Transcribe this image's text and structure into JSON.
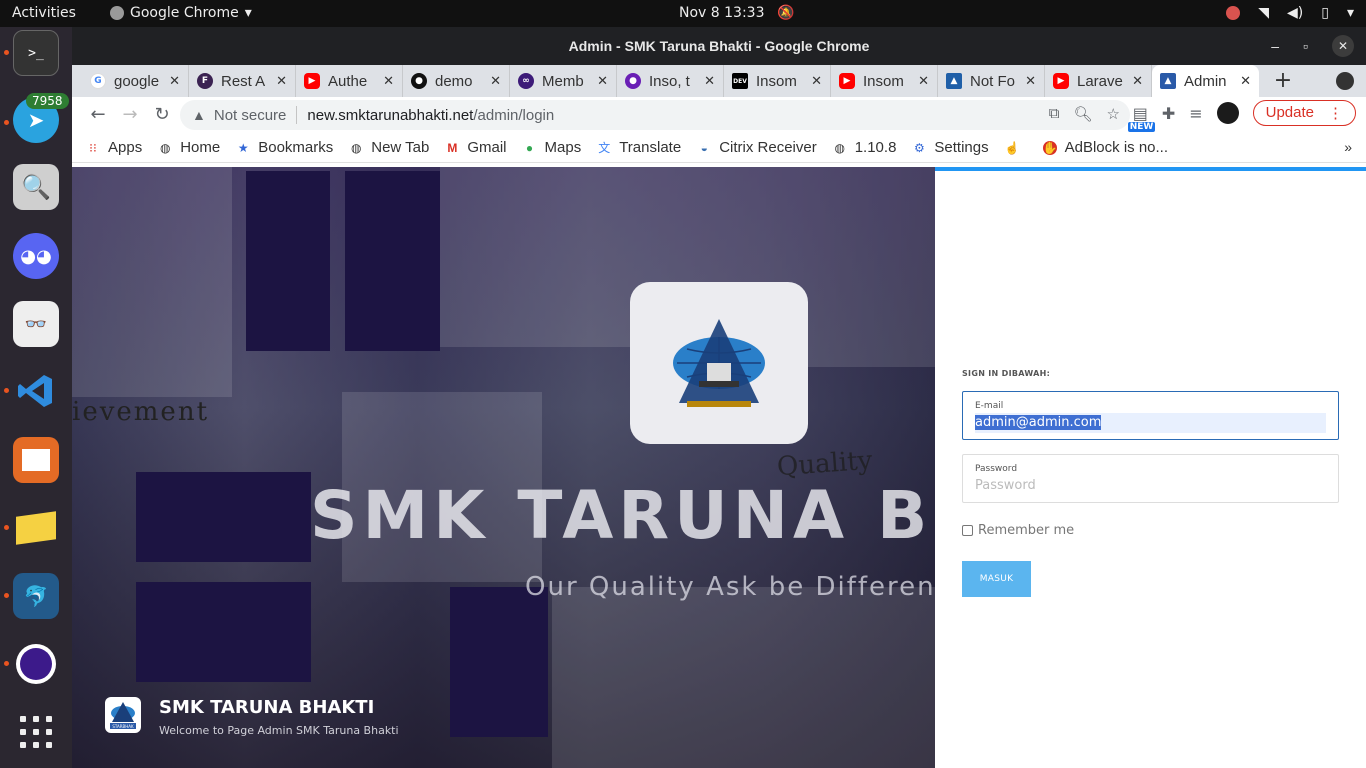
{
  "system": {
    "activities": "Activities",
    "app_name": "Google Chrome",
    "clock": "Nov 8  13:33"
  },
  "dock": {
    "telegram_badge": "7958",
    "items": [
      "terminal-icon",
      "telegram-icon",
      "magnifier-icon",
      "discord-icon",
      "document-viewer-icon",
      "vscode-icon",
      "impress-icon",
      "text-editor-icon",
      "mysql-workbench-icon",
      "eclipse-icon",
      "app-grid-icon"
    ]
  },
  "window": {
    "title": "Admin - SMK Taruna Bhakti - Google Chrome"
  },
  "tabs": [
    {
      "label": "google",
      "color": "#4285f4",
      "glyph": "G"
    },
    {
      "label": "Rest A",
      "color": "#3b2252",
      "glyph": "F"
    },
    {
      "label": "Authe",
      "color": "#ff0000",
      "glyph": "▶"
    },
    {
      "label": "demo",
      "color": "#111111",
      "glyph": "●"
    },
    {
      "label": "Memb",
      "color": "#3d1b78",
      "glyph": "∞"
    },
    {
      "label": "Inso, t",
      "color": "#6a1fb5",
      "glyph": "●"
    },
    {
      "label": "Insom",
      "color": "#000000",
      "glyph": "DEV"
    },
    {
      "label": "Insom",
      "color": "#ff0000",
      "glyph": "▶"
    },
    {
      "label": "Not Fo",
      "color": "#1f5fa8",
      "glyph": "▲"
    },
    {
      "label": "Larave",
      "color": "#ff0000",
      "glyph": "▶"
    },
    {
      "label": "Admin",
      "color": "#2a5aa8",
      "glyph": "▲"
    }
  ],
  "toolbar": {
    "not_secure": "Not secure",
    "url_host": "new.smktarunabhakti.net",
    "url_path": "/admin/login",
    "new_badge": "NEW",
    "update": "Update"
  },
  "bookmarks": [
    {
      "label": "Apps",
      "icon": "apps-grid-icon"
    },
    {
      "label": "Home",
      "icon": "globe-icon"
    },
    {
      "label": "Bookmarks",
      "icon": "star-icon"
    },
    {
      "label": "New Tab",
      "icon": "globe-icon"
    },
    {
      "label": "Gmail",
      "icon": "gmail-icon"
    },
    {
      "label": "Maps",
      "icon": "maps-pin-icon"
    },
    {
      "label": "Translate",
      "icon": "translate-icon"
    },
    {
      "label": "Citrix Receiver",
      "icon": "citrix-icon"
    },
    {
      "label": "1.10.8",
      "icon": "globe-icon"
    },
    {
      "label": "Settings",
      "icon": "gear-icon"
    },
    {
      "label": "",
      "icon": "hand-icon"
    },
    {
      "label": "AdBlock is no...",
      "icon": "adblock-icon"
    }
  ],
  "hero": {
    "big_text": "SMK TARUNA BH",
    "motto": "Our Quality Ask be Different",
    "quality": "Quality",
    "achievement": "ievement",
    "brand_title": "SMK TARUNA BHAKTI",
    "brand_sub": "Welcome to Page Admin SMK Taruna Bhakti",
    "brand_logo_text": "STARBHAK"
  },
  "login": {
    "heading": "SIGN IN DIBAWAH:",
    "email_label": "E-mail",
    "email_value": "admin@admin.com",
    "password_label": "Password",
    "password_placeholder": "Password",
    "remember": "Remember me",
    "submit": "MASUK"
  }
}
